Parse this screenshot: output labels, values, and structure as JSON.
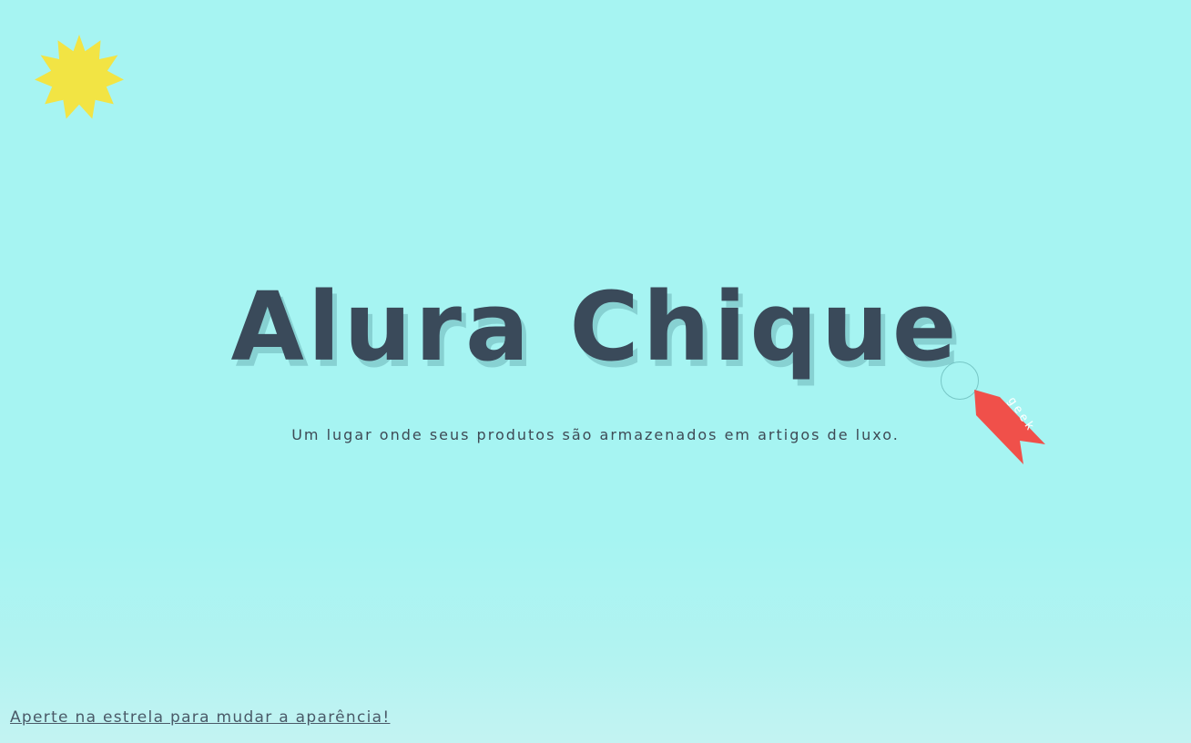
{
  "header": {
    "title": "Alura Chique",
    "subtitle": "Um lugar onde seus produtos são armazenados em artigos de luxo."
  },
  "tag": {
    "label": "geek",
    "color": "#f0504a"
  },
  "sun": {
    "icon": "sun-star-icon",
    "color": "#f2e444"
  },
  "footer": {
    "hint_link": "Aperte na estrela para mudar a aparência!"
  },
  "colors": {
    "background": "#a6f4f2",
    "text": "#3a4a5a"
  }
}
